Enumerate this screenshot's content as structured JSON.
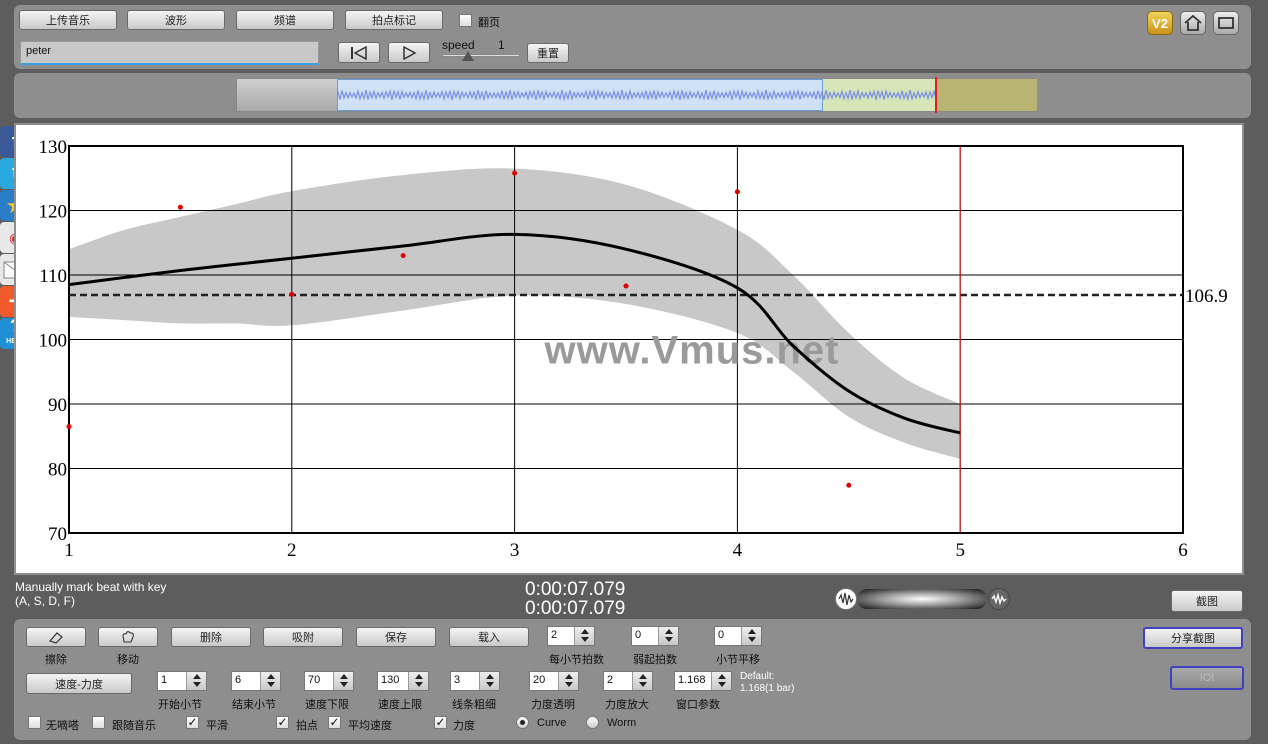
{
  "toolbar": {
    "upload": "上传音乐",
    "waveform": "波形",
    "spectrum": "频谱",
    "beat_mark": "拍点标记",
    "page_flip": "翻页",
    "name_value": "peter",
    "speed_label": "speed",
    "speed_value": "1",
    "reset": "重置"
  },
  "top_icons": {
    "v2": "V2"
  },
  "chart_data": {
    "type": "line",
    "x_ticks": [
      "1",
      "2",
      "3",
      "4",
      "5",
      "6"
    ],
    "y_ticks": [
      "130",
      "120",
      "110",
      "100",
      "90",
      "80",
      "70"
    ],
    "xlim": [
      1,
      6
    ],
    "ylim": [
      70,
      130
    ],
    "reference_line": 106.9,
    "reference_label": "106.9",
    "playhead_x": 5,
    "series": [
      {
        "type": "line",
        "x": [
          1,
          1.5,
          2,
          2.5,
          3,
          3.5,
          4,
          4.25,
          4.5,
          4.75,
          5
        ],
        "y": [
          108.5,
          110.7,
          112.6,
          114.5,
          116.3,
          114.0,
          108.0,
          99.0,
          92.0,
          87.8,
          85.5
        ]
      },
      {
        "type": "band",
        "x": [
          1,
          1.25,
          1.5,
          1.75,
          2,
          2.5,
          3,
          3.5,
          4,
          4.25,
          4.5,
          4.75,
          5
        ],
        "upper": [
          114,
          117,
          119,
          121,
          123,
          125.5,
          126.5,
          124,
          117,
          110,
          101,
          94,
          90
        ],
        "lower": [
          103.5,
          103,
          102.5,
          102.5,
          102.2,
          104.5,
          106.8,
          105.5,
          101,
          95,
          88,
          84,
          81.5
        ]
      },
      {
        "type": "scatter",
        "x": [
          1,
          1.5,
          2,
          2.5,
          3,
          3.5,
          4,
          4.5
        ],
        "y": [
          86.5,
          120.5,
          107,
          113,
          125.8,
          108.3,
          122.9,
          77.4
        ]
      }
    ]
  },
  "watermark": "www.Vmus.net",
  "status": {
    "hint_line1": "Manually mark beat with key",
    "hint_line2": "(A, S, D, F)",
    "time1": "0:00:07.079",
    "time2": "0:00:07.079",
    "screenshot": "截图"
  },
  "controls": {
    "erase": "擦除",
    "move": "移动",
    "delete": "删除",
    "snap": "吸附",
    "save": "保存",
    "load": "载入",
    "share": "分享截图",
    "ioi": "IOI",
    "tempo_force": "速度-力度",
    "beats_per_bar": {
      "label": "每小节拍数",
      "value": "2"
    },
    "weak_beats": {
      "label": "弱起拍数",
      "value": "0"
    },
    "bar_shift": {
      "label": "小节平移",
      "value": "0"
    },
    "start_bar": {
      "label": "开始小节",
      "value": "1"
    },
    "end_bar": {
      "label": "结束小节",
      "value": "6"
    },
    "tempo_min": {
      "label": "速度下限",
      "value": "70"
    },
    "tempo_max": {
      "label": "速度上限",
      "value": "130"
    },
    "line_width": {
      "label": "线条粗细",
      "value": "3"
    },
    "force_opacity": {
      "label": "力度透明",
      "value": "20"
    },
    "force_scale": {
      "label": "力度放大",
      "value": "2"
    },
    "window_param": {
      "label": "窗口参数",
      "value": "1.168"
    },
    "default_line1": "Default:",
    "default_line2": "1.168(1 bar)",
    "metronome": "无嘀嗒",
    "follow_music": "跟随音乐",
    "smooth": "平滑",
    "beat_points": "拍点",
    "avg_tempo": "平均速度",
    "force": "力度",
    "curve": "Curve",
    "worm": "Worm"
  }
}
